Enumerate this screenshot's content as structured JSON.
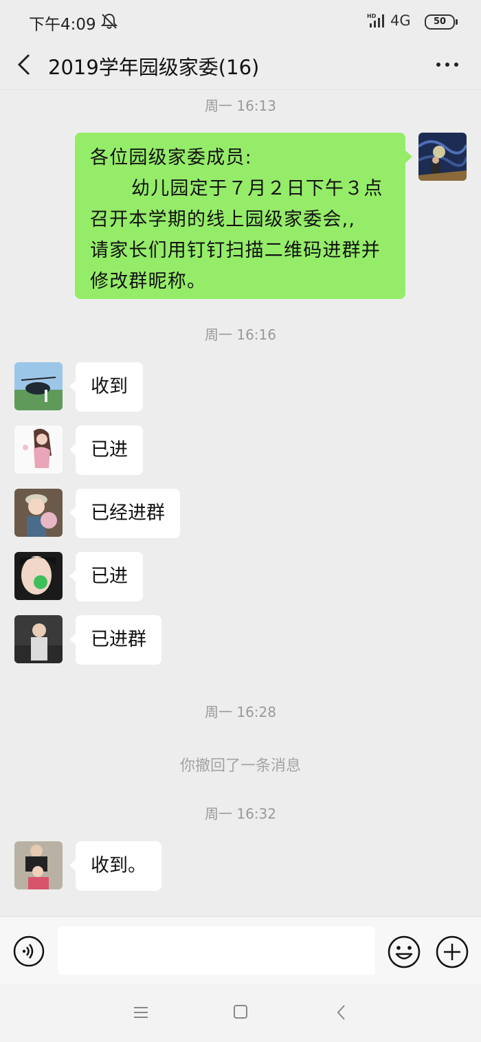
{
  "status_bar": {
    "time": "下午4:09",
    "network": "4G",
    "battery": "50"
  },
  "header": {
    "title": "2019学年园级家委(16)"
  },
  "timestamps": [
    "周一 16:13",
    "周一 16:16",
    "周一 16:28",
    "周一 16:32"
  ],
  "outgoing_message": {
    "lines": [
      "各位园级家委成员:",
      "幼儿园定于７月２日下午３点",
      "召开本学期的线上园级家委会,,",
      "请家长们用钉钉扫描二维码进群并",
      "修改群昵称。"
    ]
  },
  "incoming_messages": [
    {
      "text": "收到"
    },
    {
      "text": "已进"
    },
    {
      "text": "已经进群"
    },
    {
      "text": "已进"
    },
    {
      "text": "已进群"
    },
    {
      "text": "收到。"
    }
  ],
  "recall_notice": "你撤回了一条消息",
  "input": {
    "value": ""
  },
  "icons": [
    "back-icon",
    "more-icon",
    "voice-icon",
    "emoji-icon",
    "plus-icon",
    "menu-icon",
    "home-icon",
    "nav-back-icon"
  ]
}
